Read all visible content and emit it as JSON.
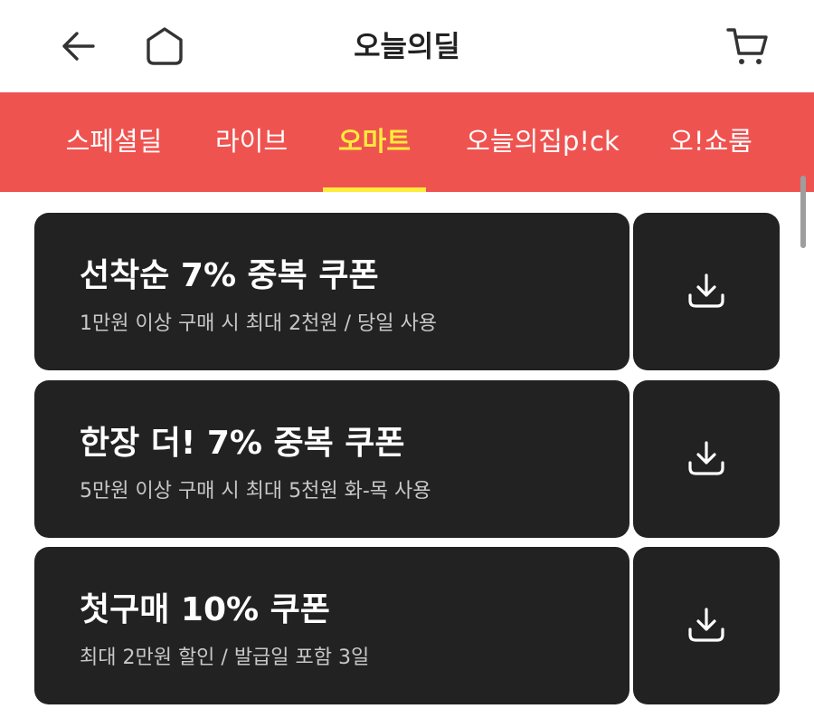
{
  "header": {
    "title": "오늘의딜",
    "back_icon": "arrow-left-icon",
    "home_icon": "home-icon",
    "cart_icon": "cart-icon"
  },
  "tabs": [
    {
      "label": "스페셜딜",
      "active": false
    },
    {
      "label": "라이브",
      "active": false
    },
    {
      "label": "오마트",
      "active": true
    },
    {
      "label": "오늘의집p!ck",
      "active": false
    },
    {
      "label": "오!쇼룸",
      "active": false
    }
  ],
  "colors": {
    "tab_bar": "#ef5350",
    "tab_active": "#ffeb3b",
    "coupon_bg": "#222222"
  },
  "coupons": [
    {
      "title": "선착순 7% 중복 쿠폰",
      "description": "1만원 이상 구매 시 최대 2천원 / 당일 사용",
      "icon": "download-icon"
    },
    {
      "title": "한장 더! 7% 중복 쿠폰",
      "description": "5만원 이상 구매 시 최대 5천원 화-목 사용",
      "icon": "download-icon"
    },
    {
      "title": "첫구매 10% 쿠폰",
      "description": "최대 2만원 할인 / 발급일 포함 3일",
      "icon": "download-icon"
    }
  ]
}
